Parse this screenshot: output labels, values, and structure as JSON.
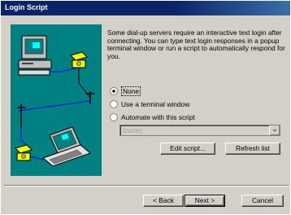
{
  "window": {
    "title": "Login Script"
  },
  "description": "Some dial-up servers require an interactive text login after connecting.  You can type text login responses in a popup terminal window or run a script to automatically respond for you.",
  "options": [
    {
      "label": "None",
      "selected": true
    },
    {
      "label": "Use a terminal window",
      "selected": false
    },
    {
      "label": "Automate with this script",
      "selected": false
    }
  ],
  "script_select": {
    "value": "(none)",
    "enabled": false
  },
  "buttons": {
    "edit_script": "Edit script...",
    "refresh_list": "Refresh list",
    "back": "< Back",
    "next": "Next >",
    "cancel": "Cancel"
  },
  "colors": {
    "titlebar": "#0a246a",
    "panel_bg": "#008080",
    "window_bg": "#d4d0c8"
  }
}
